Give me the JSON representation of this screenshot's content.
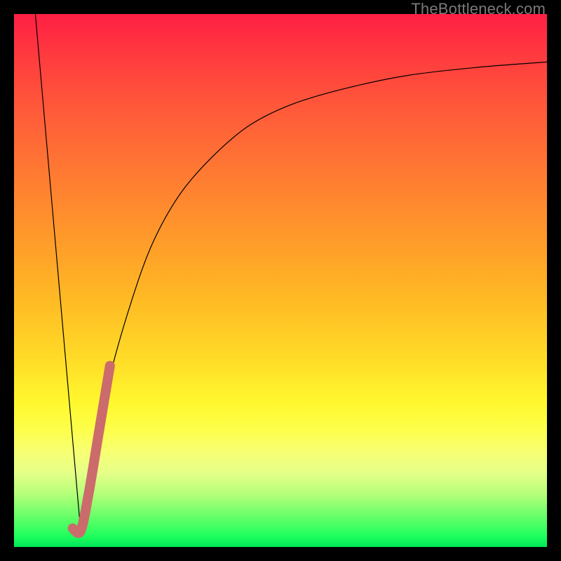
{
  "watermark": {
    "text": "TheBottleneck.com"
  },
  "chart_data": {
    "type": "line",
    "title": "",
    "xlabel": "",
    "ylabel": "",
    "xlim": [
      0,
      100
    ],
    "ylim": [
      0,
      100
    ],
    "grid": false,
    "legend": null,
    "series": [
      {
        "name": "left-descent",
        "x": [
          4,
          12.5
        ],
        "y": [
          100,
          3
        ],
        "stroke": "#000000",
        "width": 1.2
      },
      {
        "name": "right-saturating-curve",
        "x": [
          12.5,
          15,
          18,
          22,
          26,
          31,
          37,
          44,
          52,
          62,
          74,
          87,
          100
        ],
        "y": [
          3,
          17,
          32,
          46,
          57,
          66,
          73,
          79,
          83,
          86,
          88.5,
          90,
          91
        ],
        "stroke": "#000000",
        "width": 1.2
      },
      {
        "name": "highlight-segment",
        "x": [
          11,
          12.5,
          14,
          16,
          18
        ],
        "y": [
          3.5,
          3,
          10,
          22,
          34
        ],
        "stroke": "#cc6b6b",
        "width": 14
      }
    ]
  },
  "colors": {
    "background_frame": "#000000",
    "gradient_top": "#ff1f44",
    "gradient_bottom": "#00e85a",
    "curve": "#000000",
    "highlight": "#cc6b6b",
    "watermark": "#7a7a7a"
  }
}
